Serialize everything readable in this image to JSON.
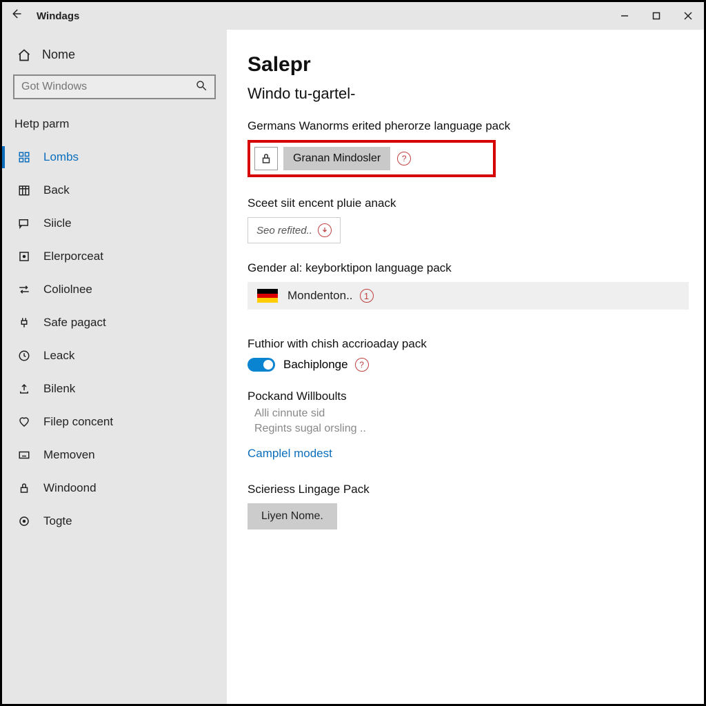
{
  "titlebar": {
    "title": "Windags"
  },
  "sidebar": {
    "home": "Nome",
    "search_placeholder": "Got Windows",
    "section": "Hetp parm",
    "items": [
      {
        "label": "Lombs",
        "active": true
      },
      {
        "label": "Back"
      },
      {
        "label": "Siicle"
      },
      {
        "label": "Elerporceat"
      },
      {
        "label": "Coliolnee"
      },
      {
        "label": "Safe pagact"
      },
      {
        "label": "Leack"
      },
      {
        "label": "Bilenk"
      },
      {
        "label": "Filep concent"
      },
      {
        "label": "Memoven"
      },
      {
        "label": "Windoond"
      },
      {
        "label": "Togte"
      }
    ]
  },
  "content": {
    "page_title": "Salepr",
    "subtitle": "Windo tu-gartel-",
    "section1_text": "Germans Wanorms erited pherorze language pack",
    "highlight_btn": "Granan Mindosler",
    "section2_text": "Sceet siit encent pluie anack",
    "related_label": "Seo refited..",
    "section3_text": "Gender al: keyborktipon language pack",
    "lang_name": "Mondenton..",
    "lang_badge": "1",
    "section4_text": "Futhior with chish accrioaday pack",
    "toggle_label": "Bachiplonge",
    "section5_title": "Pockand Willboults",
    "section5_line1": "Alli cinnute sid",
    "section5_line2": "Regints sugal orsling ..",
    "link_text": "Camplel modest",
    "section6_title": "Scieriess Lingage Pack",
    "final_btn": "Liyen Nome."
  }
}
